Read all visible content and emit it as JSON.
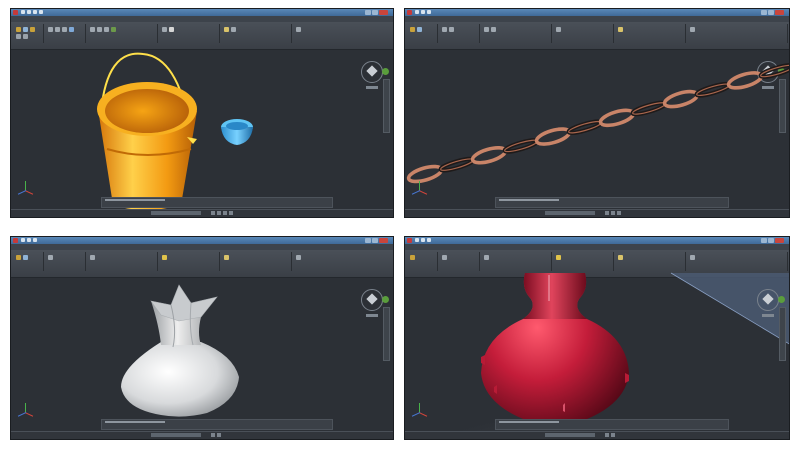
{
  "screens": [
    {
      "id": "bucket",
      "object": "bucket-model"
    },
    {
      "id": "chain",
      "object": "chain-model"
    },
    {
      "id": "vase-star",
      "object": "star-vase-model"
    },
    {
      "id": "vase-red",
      "object": "red-vase-model"
    }
  ],
  "colors": {
    "viewport_bg": "#2c3036",
    "ribbon": "#434950",
    "titlebar": "#4b79aa",
    "bucket": "#f2a019",
    "bowl": "#3fb1e8",
    "chain": "#c98468",
    "vase_white": "#e9ebed",
    "vase_red": "#c41d3a"
  }
}
